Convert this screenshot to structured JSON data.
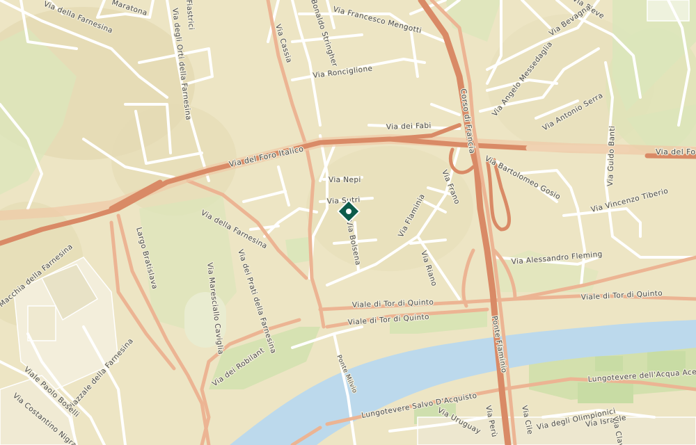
{
  "map": {
    "marker": {
      "color": "#0d5c4a"
    },
    "colors": {
      "land": "#ede5c4",
      "river": "#bcd9ec",
      "park": "#dce6bb",
      "minor_road": "#ffffff",
      "major_road": "#e59576",
      "highway": "#d98a66"
    },
    "labels": {
      "via_della_farnesina_nw": "Via della Farnesina",
      "maratona": "Maratona",
      "via_degli_orti": "Via degli Orti della Farnesina",
      "fiastrici": "Fiastrici",
      "via_cassia": "Via Cassia",
      "stringher": "Bonaldo Stringher",
      "via_mengotti": "Via Francesco Mengotti",
      "via_ronciglione": "Via Ronciglione",
      "corso_di_francia": "Corso di Francia",
      "via_pieve": "Via Pieve",
      "via_bevagna": "Via Bevagna",
      "via_messedaglia": "Via Angelo Messedaglia",
      "via_serra": "Via Antonio Serra",
      "via_dei_fabi": "Via dei Fabi",
      "via_del_foro_italico": "Via del Foro Italico",
      "via_del_foro_e": "Via del Fo",
      "via_guido_banti": "Via Guido Banti",
      "via_nepi": "Via Nepi",
      "via_sutri": "Via Sutri",
      "via_bolsena": "Via Bolsena",
      "via_flaminia": "Via Flaminia",
      "via_frano": "Via Frano",
      "via_gosio": "Via Bartolomeo Gosio",
      "via_tiberio": "Via Vincenzo Tiberio",
      "via_della_farnesina": "Via della Farnesina",
      "via_fleming": "Via Alessandro Fleming",
      "via_dei_prati": "Via dei Prati della Farnesina",
      "via_riano": "Via Riano",
      "largo_bratislava": "Largo Bratislava",
      "via_cavaglia": "Via Maresciallo Caviglia",
      "viale_tor_quinto_1": "Viale di Tor di Quinto",
      "viale_tor_quinto_2": "Viale di Tor di Quinto",
      "viale_tor_quinto_e": "Viale di Tor di Quinto",
      "macchia": "Macchia della Farnesina",
      "ponte_flaminio": "Ponte Flaminio",
      "via_robilant": "Via dei Robilant",
      "piazzale_farnesina": "Piazzale della Farnesina",
      "ponte_milvio": "Ponte Milvio",
      "viale_boselli": "Viale Paolo Boselli",
      "via_costantino": "Via Costantino Nigra",
      "lungotevere_acquisto": "Lungotevere Salvo D'Acquisto",
      "lungotevere_acqua": "Lungotevere dell'Acqua Ace",
      "via_uruguay": "Via Uruguay",
      "via_peru": "Via Perù",
      "via_cile": "Via Cile",
      "via_olimpionici": "Via degli Olimpionici",
      "via_israele": "Via Israele",
      "via_clavia": "Via Clavia"
    }
  }
}
